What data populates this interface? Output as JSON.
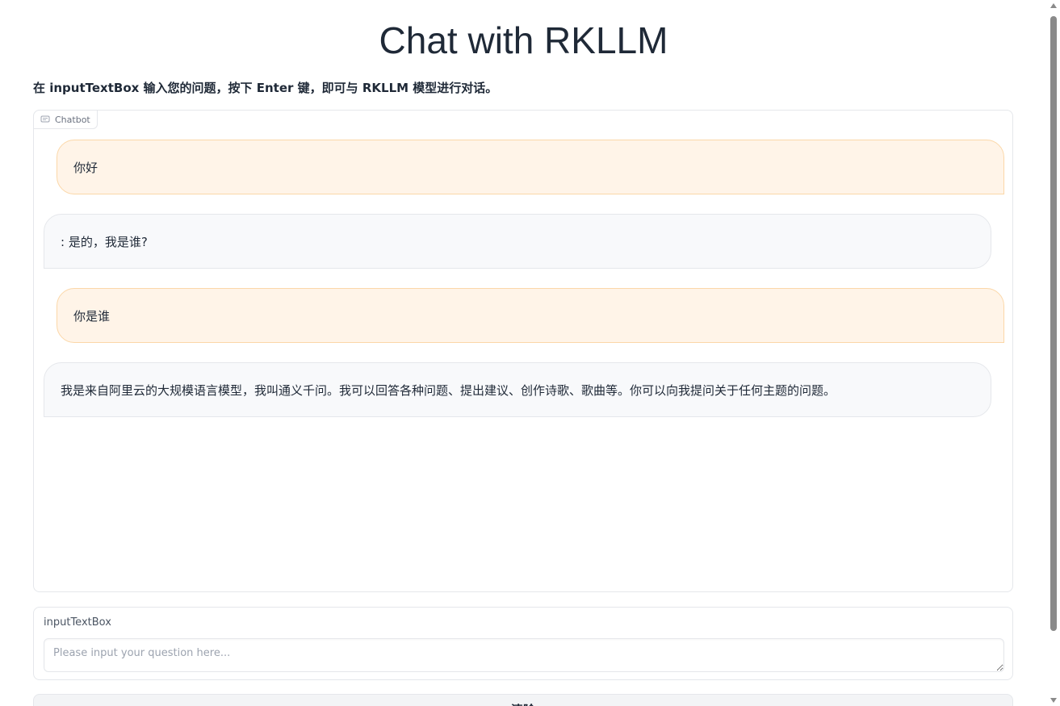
{
  "page": {
    "title": "Chat with RKLLM",
    "description": "在 inputTextBox 输入您的问题，按下 Enter 键，即可与 RKLLM 模型进行对话。"
  },
  "chatbot": {
    "label": "Chatbot",
    "label_icon": "chat-bubble-icon",
    "messages": [
      {
        "role": "user",
        "text": "你好"
      },
      {
        "role": "bot",
        "text": ": 是的，我是谁?"
      },
      {
        "role": "user",
        "text": "你是谁"
      },
      {
        "role": "bot",
        "text": "我是来自阿里云的大规模语言模型，我叫通义千问。我可以回答各种问题、提出建议、创作诗歌、歌曲等。你可以向我提问关于任何主题的问题。"
      }
    ]
  },
  "input": {
    "label": "inputTextBox",
    "placeholder": "Please input your question here...",
    "value": ""
  },
  "clear_button": {
    "label": "清除"
  },
  "colors": {
    "user_bubble_bg": "#fff4e8",
    "user_bubble_border": "#fbd7a8",
    "bot_bubble_bg": "#f8f9fb",
    "border": "#e5e7eb"
  }
}
